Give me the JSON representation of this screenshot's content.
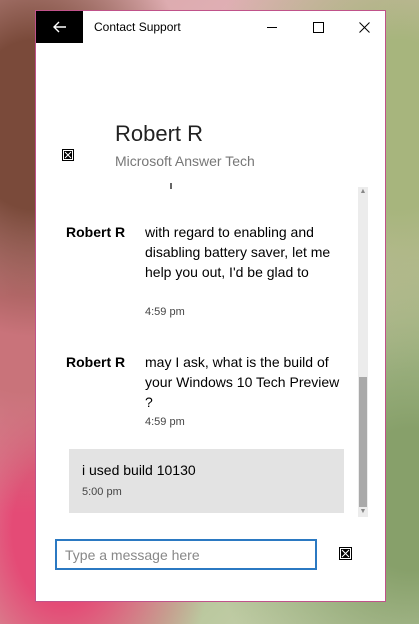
{
  "window": {
    "title": "Contact Support"
  },
  "agent": {
    "name": "Robert R",
    "role": "Microsoft Answer Tech"
  },
  "messages": [
    {
      "sender": "Robert R",
      "text": "with regard to enabling and disabling battery saver, let me help you out, I'd be glad to",
      "time": "4:59 pm"
    },
    {
      "sender": "Robert R",
      "text": "may I ask, what is the build of your Windows 10 Tech Preview ?",
      "time": "4:59 pm"
    }
  ],
  "user_message": {
    "text": "i used build 10130",
    "time": "5:00 pm"
  },
  "composer": {
    "placeholder": "Type a message here"
  },
  "icons": {
    "back": "back-arrow-icon",
    "minimize": "minimize-icon",
    "maximize": "maximize-icon",
    "close": "close-icon",
    "broken_image": "broken-image-icon"
  },
  "colors": {
    "accent": "#2b79c2",
    "window_border": "#c0528a"
  }
}
